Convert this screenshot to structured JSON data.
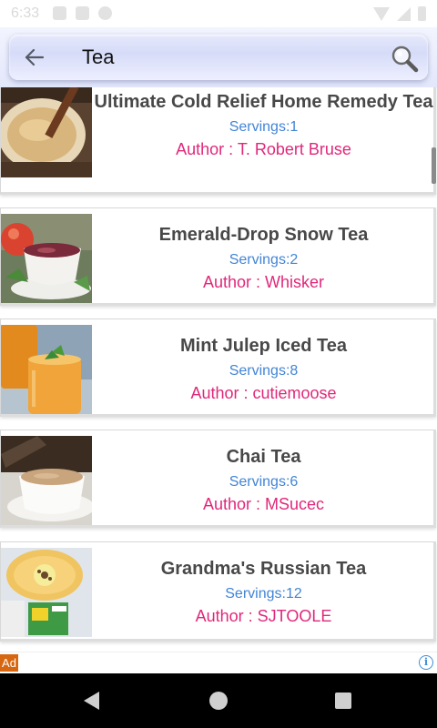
{
  "status_bar": {
    "time": "6:33"
  },
  "search": {
    "query": "Tea"
  },
  "recipes": [
    {
      "title": "Ultimate Cold Relief Home Remedy Tea",
      "servings": "Servings:1",
      "author": "Author : T. Robert Bruse",
      "thumbnail": "tea-with-cinnamon-stick-photo"
    },
    {
      "title": "Emerald-Drop Snow Tea",
      "servings": "Servings:2",
      "author": "Author : Whisker",
      "thumbnail": "teacup-with-apple-photo"
    },
    {
      "title": "Mint Julep Iced Tea",
      "servings": "Servings:8",
      "author": "Author : cutiemoose",
      "thumbnail": "iced-tea-glasses-photo"
    },
    {
      "title": "Chai Tea",
      "servings": "Servings:6",
      "author": "Author : MSucec",
      "thumbnail": "chai-cup-photo"
    },
    {
      "title": "Grandma's Russian Tea",
      "servings": "Servings:12",
      "author": "Author : SJTOOLE",
      "thumbnail": "russian-tea-with-lemon-photo"
    }
  ],
  "ad": {
    "label": "Ad",
    "info_icon": "i"
  },
  "colors": {
    "servings": "#4285d6",
    "author": "#e0287a",
    "title": "#484848"
  }
}
